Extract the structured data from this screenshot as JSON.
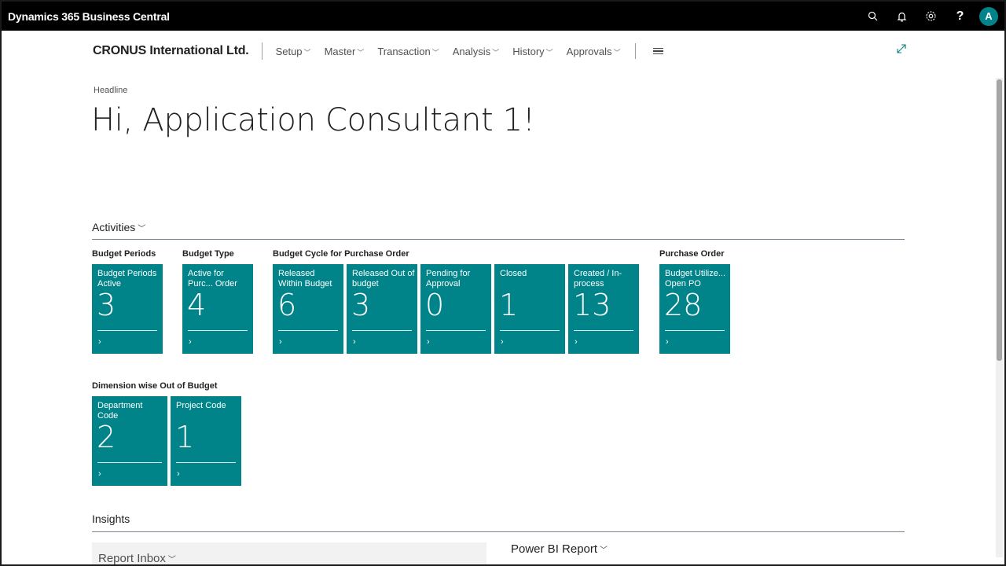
{
  "app": {
    "title": "Dynamics 365 Business Central",
    "avatar_initial": "A"
  },
  "topbar_icons": [
    {
      "name": "search-icon",
      "glyph": "⌕"
    },
    {
      "name": "bell-icon",
      "glyph": "🔔"
    },
    {
      "name": "gear-icon",
      "glyph": "⚙"
    },
    {
      "name": "help-icon",
      "glyph": "?"
    }
  ],
  "nav": {
    "company": "CRONUS International Ltd.",
    "items": [
      "Setup",
      "Master",
      "Transaction",
      "Analysis",
      "History",
      "Approvals"
    ]
  },
  "headline": {
    "caption": "Headline",
    "title": "Hi, Application Consultant 1!"
  },
  "activities": {
    "title": "Activities",
    "groups": [
      {
        "label": "Budget Periods",
        "tiles": [
          {
            "label": "Budget Periods Active",
            "value": "3"
          }
        ]
      },
      {
        "label": "Budget Type",
        "tiles": [
          {
            "label": "Active for Purc... Order",
            "value": "4"
          }
        ]
      },
      {
        "label": "Budget Cycle for Purchase Order",
        "tiles": [
          {
            "label": "Released Within Budget",
            "value": "6"
          },
          {
            "label": "Released Out of budget",
            "value": "3"
          },
          {
            "label": "Pending for Approval",
            "value": "0"
          },
          {
            "label": "Closed",
            "value": "1"
          },
          {
            "label": "Created / In-process",
            "value": "13"
          }
        ]
      },
      {
        "label": "Purchase Order",
        "tiles": [
          {
            "label": "Budget Utilize... Open PO",
            "value": "28"
          }
        ]
      },
      {
        "label": "Dimension wise Out of Budget",
        "tiles": [
          {
            "label": "Department Code",
            "value": "2"
          },
          {
            "label": "Project Code",
            "value": "1"
          }
        ]
      }
    ],
    "tile_arrow": "›"
  },
  "insights": {
    "title": "Insights",
    "report_inbox": "Report Inbox",
    "power_bi": "Power BI Report"
  },
  "colors": {
    "tile": "#008489",
    "topbar": "#000000",
    "avatar": "#00838a"
  }
}
